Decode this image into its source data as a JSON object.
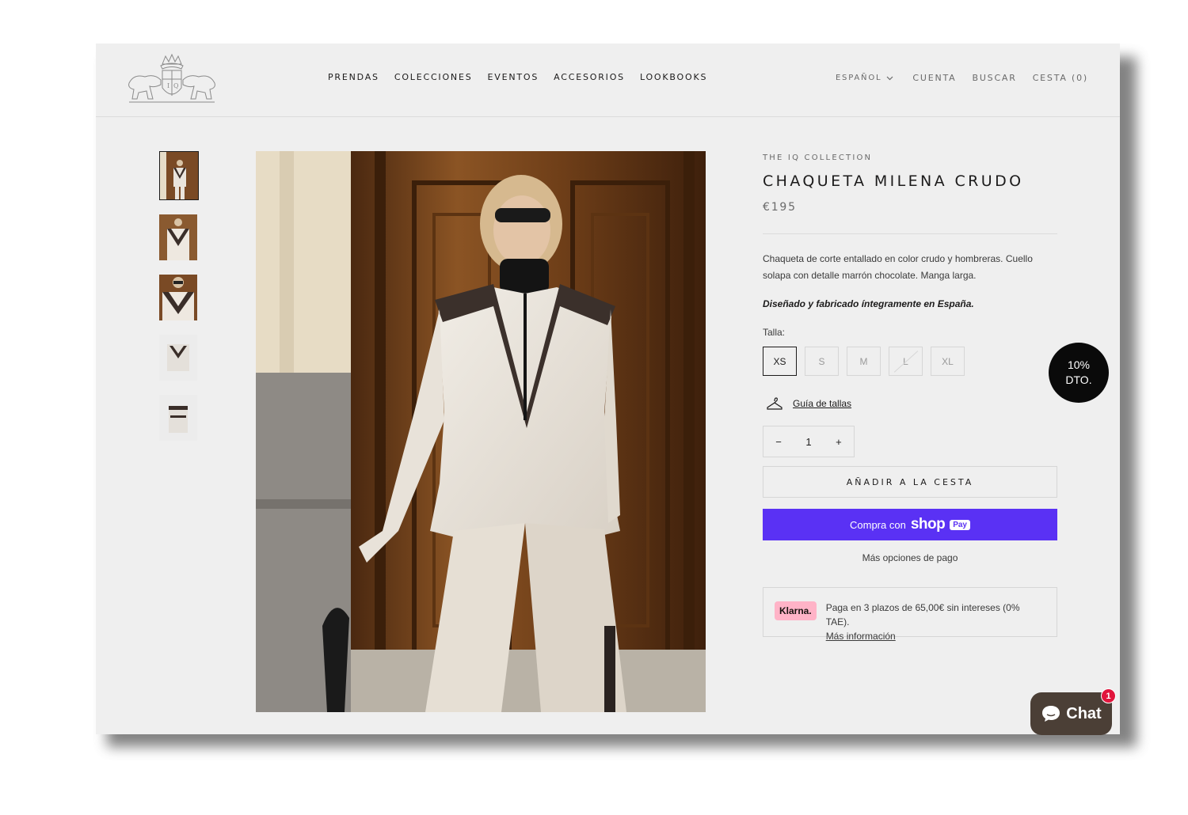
{
  "header": {
    "nav": [
      "PRENDAS",
      "COLECCIONES",
      "EVENTOS",
      "ACCESORIOS",
      "LOOKBOOKS"
    ],
    "language": "ESPAÑOL",
    "account": "CUENTA",
    "search": "BUSCAR",
    "cart": "CESTA (0)"
  },
  "gallery": {
    "thumbnails": [
      "thumb-1",
      "thumb-2",
      "thumb-3",
      "thumb-4",
      "thumb-5"
    ],
    "selected_index": 0
  },
  "product": {
    "vendor": "THE IQ COLLECTION",
    "title": "CHAQUETA MILENA CRUDO",
    "price": "€195",
    "description": "Chaqueta de corte entallado en color crudo y hombreras. Cuello solapa con detalle marrón chocolate. Manga larga.",
    "made_in": "Diseñado y fabricado íntegramente en España.",
    "size_label": "Talla:",
    "sizes": [
      {
        "label": "XS",
        "selected": true,
        "available": true
      },
      {
        "label": "S",
        "selected": false,
        "available": true
      },
      {
        "label": "M",
        "selected": false,
        "available": true
      },
      {
        "label": "L",
        "selected": false,
        "available": false
      },
      {
        "label": "XL",
        "selected": false,
        "available": true
      }
    ],
    "size_guide": "Guía de tallas",
    "quantity": "1",
    "qty_minus": "−",
    "qty_plus": "+",
    "add_to_cart": "AÑADIR A LA CESTA",
    "shop_pay_prefix": "Compra con",
    "shop_pay_brand": "shop",
    "shop_pay_badge": "Pay",
    "more_payment": "Más opciones de pago",
    "klarna": {
      "logo": "Klarna.",
      "text": "Paga en 3 plazos de 65,00€ sin intereses (0% TAE).",
      "link": "Más información"
    }
  },
  "promo": {
    "line1": "10%",
    "line2": "DTO."
  },
  "chat": {
    "label": "Chat",
    "badge": "1"
  },
  "colors": {
    "page_bg": "#efefef",
    "text": "#1c1b1b",
    "shop_pay": "#5a31f4",
    "klarna_pink": "#ffb3c7",
    "chat_bg": "#4b3f36",
    "badge_red": "#e1153c"
  }
}
